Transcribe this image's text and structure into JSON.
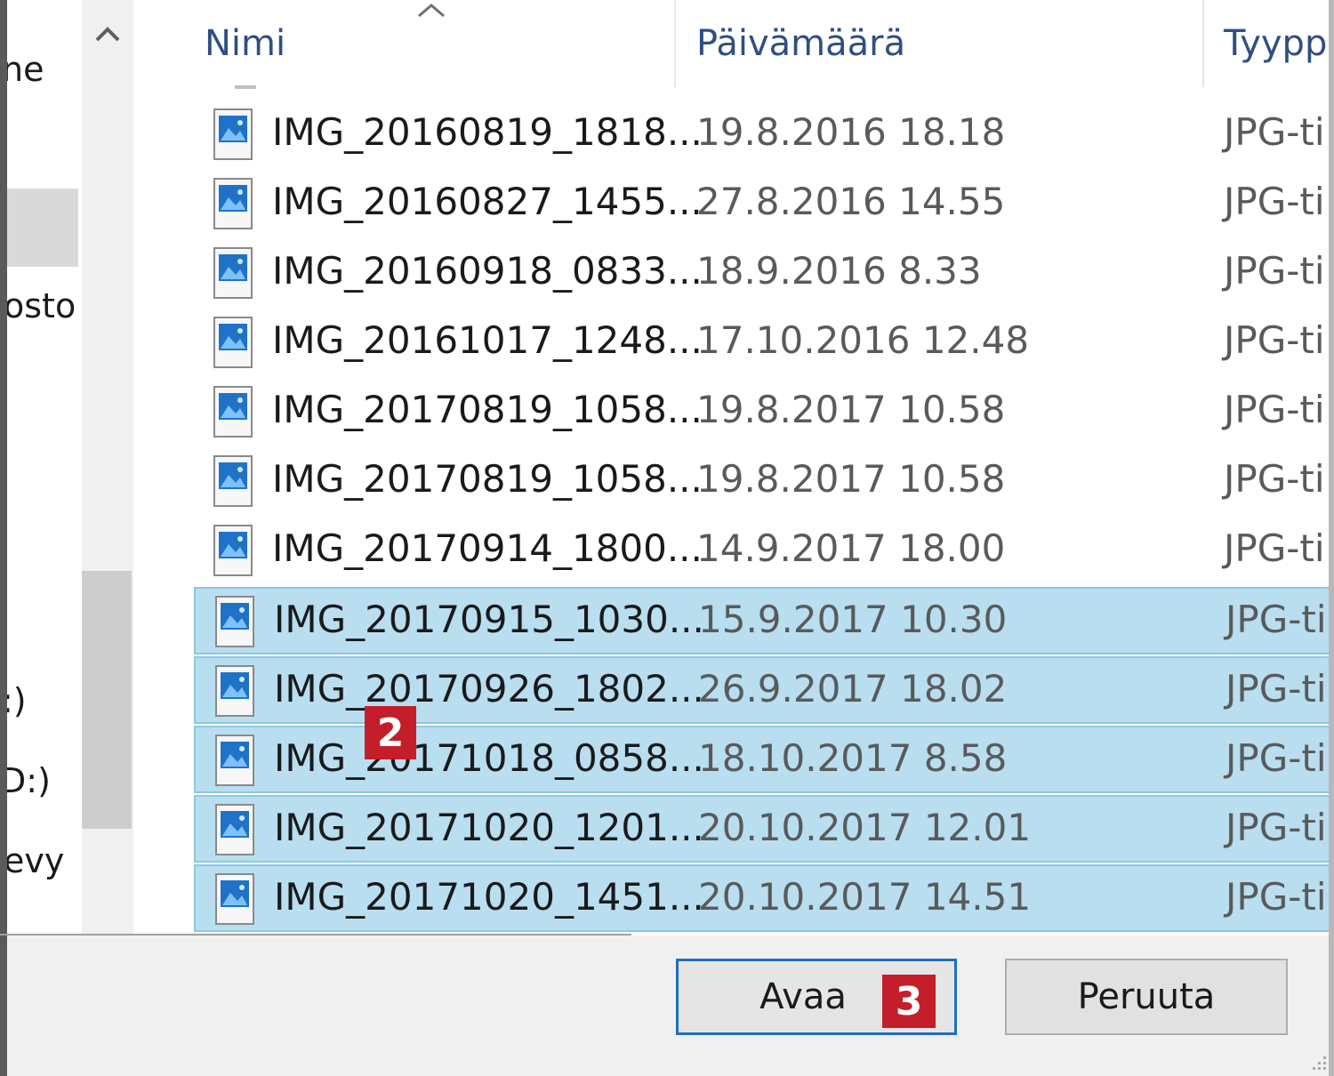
{
  "nav": {
    "items": [
      "ne",
      "osto",
      ":)",
      "D:)",
      "evy"
    ]
  },
  "columns": {
    "name": "Nimi",
    "date": "Päivämäärä",
    "type": "Tyypp"
  },
  "files": [
    {
      "name": "IMG_20160819_1818...",
      "date": "19.8.2016 18.18",
      "type": "JPG-ti",
      "selected": false
    },
    {
      "name": "IMG_20160827_1455...",
      "date": "27.8.2016 14.55",
      "type": "JPG-ti",
      "selected": false
    },
    {
      "name": "IMG_20160918_0833...",
      "date": "18.9.2016 8.33",
      "type": "JPG-ti",
      "selected": false
    },
    {
      "name": "IMG_20161017_1248...",
      "date": "17.10.2016 12.48",
      "type": "JPG-ti",
      "selected": false
    },
    {
      "name": "IMG_20170819_1058...",
      "date": "19.8.2017 10.58",
      "type": "JPG-ti",
      "selected": false
    },
    {
      "name": "IMG_20170819_1058...",
      "date": "19.8.2017 10.58",
      "type": "JPG-ti",
      "selected": false
    },
    {
      "name": "IMG_20170914_1800...",
      "date": "14.9.2017 18.00",
      "type": "JPG-ti",
      "selected": false
    },
    {
      "name": "IMG_20170915_1030...",
      "date": "15.9.2017 10.30",
      "type": "JPG-ti",
      "selected": true
    },
    {
      "name": "IMG_20170926_1802...",
      "date": "26.9.2017 18.02",
      "type": "JPG-ti",
      "selected": true
    },
    {
      "name": "IMG_20171018_0858...",
      "date": "18.10.2017 8.58",
      "type": "JPG-ti",
      "selected": true
    },
    {
      "name": "IMG_20171020_1201...",
      "date": "20.10.2017 12.01",
      "type": "JPG-ti",
      "selected": true
    },
    {
      "name": "IMG_20171020_1451...",
      "date": "20.10.2017 14.51",
      "type": "JPG-ti",
      "selected": true
    }
  ],
  "buttons": {
    "open": "Avaa",
    "cancel": "Peruuta"
  },
  "badges": {
    "step2": "2",
    "step3": "3"
  },
  "icons": {
    "file": "jpg-file-icon",
    "sort": "sort-ascending-icon",
    "scroll_up": "chevron-up-icon"
  },
  "colors": {
    "selection": "#b8def0",
    "selection_border": "#8cc7e6",
    "header_text": "#2f4f80",
    "badge": "#c41e2a",
    "default_button_border": "#1f6fc0"
  }
}
